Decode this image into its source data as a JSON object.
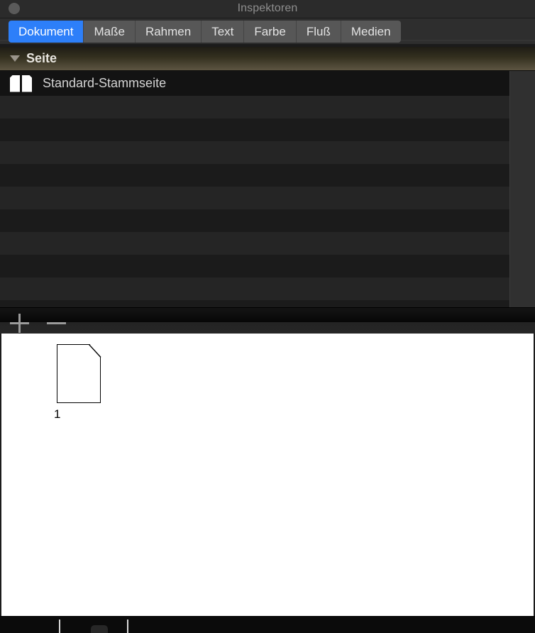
{
  "window": {
    "title": "Inspektoren",
    "close_button_icon": "close-circle-icon"
  },
  "tabs": {
    "selected": "Dokument",
    "items": [
      {
        "label": "Dokument",
        "active": true
      },
      {
        "label": "Maße",
        "active": false
      },
      {
        "label": "Rahmen",
        "active": false
      },
      {
        "label": "Text",
        "active": false
      },
      {
        "label": "Farbe",
        "active": false
      },
      {
        "label": "Fluß",
        "active": false
      },
      {
        "label": "Medien",
        "active": false
      }
    ]
  },
  "section": {
    "disclosure_icon": "triangle-down-icon",
    "title": "Seite",
    "expanded": true
  },
  "page_list": {
    "selected_row": {
      "icon": "facing-pages-icon",
      "label": "Standard-Stammseite"
    },
    "empty_rows": 10
  },
  "list_toolbar": {
    "add_label": "+",
    "add_icon": "plus-icon",
    "remove_label": "−",
    "remove_icon": "minus-icon"
  },
  "canvas": {
    "page_thumbnail_icon": "page-document-icon",
    "page_number": "1"
  },
  "colors": {
    "accent_blue": "#2d7ff9",
    "tab_inactive": "#575757",
    "window_chrome": "#2b2b2b",
    "list_stripe_light": "#252525",
    "list_stripe_dark": "#1b1b1b",
    "row_selected": "#131313",
    "section_header_olive": "#5d5542",
    "canvas_background": "#ffffff"
  }
}
